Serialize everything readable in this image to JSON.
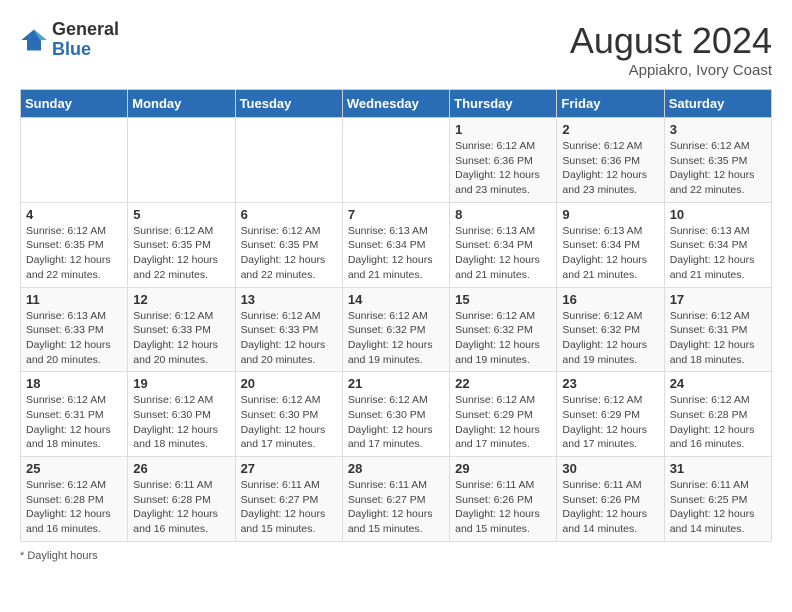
{
  "header": {
    "logo_general": "General",
    "logo_blue": "Blue",
    "month_year": "August 2024",
    "location": "Appiakro, Ivory Coast"
  },
  "days_of_week": [
    "Sunday",
    "Monday",
    "Tuesday",
    "Wednesday",
    "Thursday",
    "Friday",
    "Saturday"
  ],
  "footer": {
    "note": "Daylight hours"
  },
  "weeks": [
    [
      {
        "day": "",
        "info": ""
      },
      {
        "day": "",
        "info": ""
      },
      {
        "day": "",
        "info": ""
      },
      {
        "day": "",
        "info": ""
      },
      {
        "day": "1",
        "info": "Sunrise: 6:12 AM\nSunset: 6:36 PM\nDaylight: 12 hours and 23 minutes."
      },
      {
        "day": "2",
        "info": "Sunrise: 6:12 AM\nSunset: 6:36 PM\nDaylight: 12 hours and 23 minutes."
      },
      {
        "day": "3",
        "info": "Sunrise: 6:12 AM\nSunset: 6:35 PM\nDaylight: 12 hours and 22 minutes."
      }
    ],
    [
      {
        "day": "4",
        "info": "Sunrise: 6:12 AM\nSunset: 6:35 PM\nDaylight: 12 hours and 22 minutes."
      },
      {
        "day": "5",
        "info": "Sunrise: 6:12 AM\nSunset: 6:35 PM\nDaylight: 12 hours and 22 minutes."
      },
      {
        "day": "6",
        "info": "Sunrise: 6:12 AM\nSunset: 6:35 PM\nDaylight: 12 hours and 22 minutes."
      },
      {
        "day": "7",
        "info": "Sunrise: 6:13 AM\nSunset: 6:34 PM\nDaylight: 12 hours and 21 minutes."
      },
      {
        "day": "8",
        "info": "Sunrise: 6:13 AM\nSunset: 6:34 PM\nDaylight: 12 hours and 21 minutes."
      },
      {
        "day": "9",
        "info": "Sunrise: 6:13 AM\nSunset: 6:34 PM\nDaylight: 12 hours and 21 minutes."
      },
      {
        "day": "10",
        "info": "Sunrise: 6:13 AM\nSunset: 6:34 PM\nDaylight: 12 hours and 21 minutes."
      }
    ],
    [
      {
        "day": "11",
        "info": "Sunrise: 6:13 AM\nSunset: 6:33 PM\nDaylight: 12 hours and 20 minutes."
      },
      {
        "day": "12",
        "info": "Sunrise: 6:12 AM\nSunset: 6:33 PM\nDaylight: 12 hours and 20 minutes."
      },
      {
        "day": "13",
        "info": "Sunrise: 6:12 AM\nSunset: 6:33 PM\nDaylight: 12 hours and 20 minutes."
      },
      {
        "day": "14",
        "info": "Sunrise: 6:12 AM\nSunset: 6:32 PM\nDaylight: 12 hours and 19 minutes."
      },
      {
        "day": "15",
        "info": "Sunrise: 6:12 AM\nSunset: 6:32 PM\nDaylight: 12 hours and 19 minutes."
      },
      {
        "day": "16",
        "info": "Sunrise: 6:12 AM\nSunset: 6:32 PM\nDaylight: 12 hours and 19 minutes."
      },
      {
        "day": "17",
        "info": "Sunrise: 6:12 AM\nSunset: 6:31 PM\nDaylight: 12 hours and 18 minutes."
      }
    ],
    [
      {
        "day": "18",
        "info": "Sunrise: 6:12 AM\nSunset: 6:31 PM\nDaylight: 12 hours and 18 minutes."
      },
      {
        "day": "19",
        "info": "Sunrise: 6:12 AM\nSunset: 6:30 PM\nDaylight: 12 hours and 18 minutes."
      },
      {
        "day": "20",
        "info": "Sunrise: 6:12 AM\nSunset: 6:30 PM\nDaylight: 12 hours and 17 minutes."
      },
      {
        "day": "21",
        "info": "Sunrise: 6:12 AM\nSunset: 6:30 PM\nDaylight: 12 hours and 17 minutes."
      },
      {
        "day": "22",
        "info": "Sunrise: 6:12 AM\nSunset: 6:29 PM\nDaylight: 12 hours and 17 minutes."
      },
      {
        "day": "23",
        "info": "Sunrise: 6:12 AM\nSunset: 6:29 PM\nDaylight: 12 hours and 17 minutes."
      },
      {
        "day": "24",
        "info": "Sunrise: 6:12 AM\nSunset: 6:28 PM\nDaylight: 12 hours and 16 minutes."
      }
    ],
    [
      {
        "day": "25",
        "info": "Sunrise: 6:12 AM\nSunset: 6:28 PM\nDaylight: 12 hours and 16 minutes."
      },
      {
        "day": "26",
        "info": "Sunrise: 6:11 AM\nSunset: 6:28 PM\nDaylight: 12 hours and 16 minutes."
      },
      {
        "day": "27",
        "info": "Sunrise: 6:11 AM\nSunset: 6:27 PM\nDaylight: 12 hours and 15 minutes."
      },
      {
        "day": "28",
        "info": "Sunrise: 6:11 AM\nSunset: 6:27 PM\nDaylight: 12 hours and 15 minutes."
      },
      {
        "day": "29",
        "info": "Sunrise: 6:11 AM\nSunset: 6:26 PM\nDaylight: 12 hours and 15 minutes."
      },
      {
        "day": "30",
        "info": "Sunrise: 6:11 AM\nSunset: 6:26 PM\nDaylight: 12 hours and 14 minutes."
      },
      {
        "day": "31",
        "info": "Sunrise: 6:11 AM\nSunset: 6:25 PM\nDaylight: 12 hours and 14 minutes."
      }
    ]
  ]
}
